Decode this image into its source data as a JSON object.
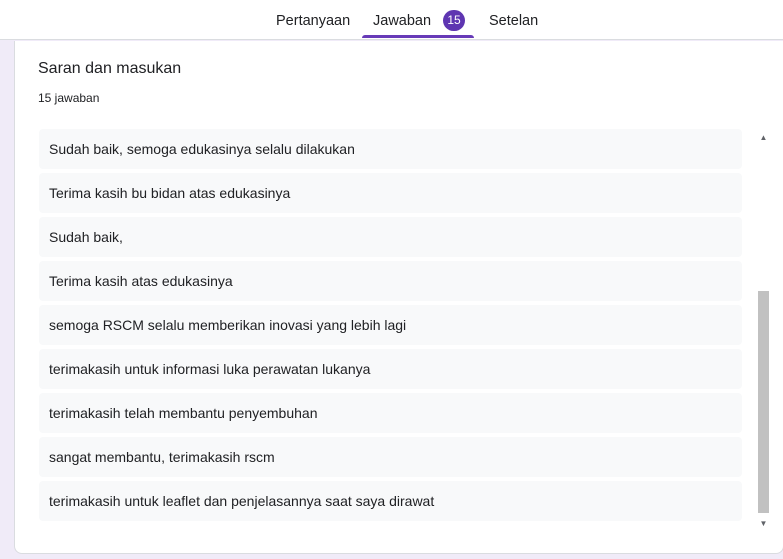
{
  "tabs": [
    {
      "label": "Pertanyaan"
    },
    {
      "label": "Jawaban",
      "badge": "15"
    },
    {
      "label": "Setelan"
    }
  ],
  "colors": {
    "accent": "#673ab7",
    "badge": "#5e35b1",
    "background": "#f0ebf8"
  },
  "question": {
    "title": "Saran dan masukan",
    "count": "15 jawaban"
  },
  "responses": [
    "Sudah baik, semoga edukasinya selalu dilakukan",
    "Terima kasih bu bidan atas edukasinya",
    "Sudah baik,",
    "Terima kasih atas edukasinya",
    "semoga RSCM selalu memberikan inovasi yang lebih lagi",
    "terimakasih untuk informasi luka perawatan lukanya",
    "terimakasih telah membantu penyembuhan",
    "sangat membantu, terimakasih rscm",
    "terimakasih untuk leaflet dan penjelasannya saat saya dirawat"
  ],
  "icons": {
    "scroll_up": "▲",
    "scroll_down": "▼"
  }
}
